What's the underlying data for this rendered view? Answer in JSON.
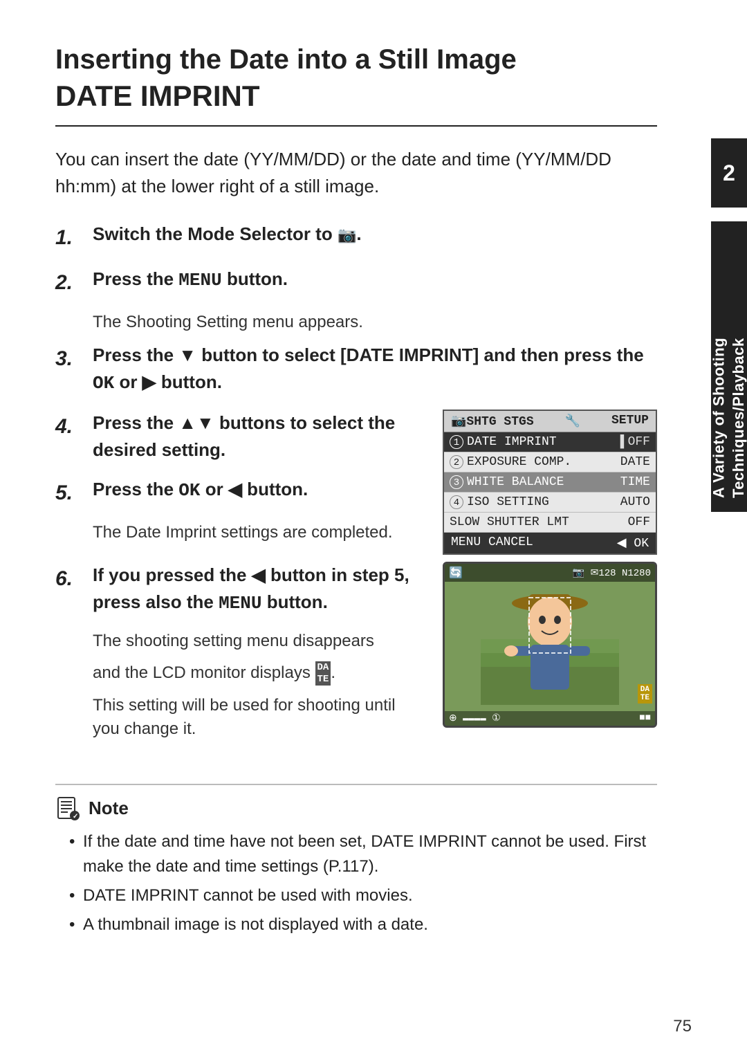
{
  "page": {
    "title_main": "Inserting the Date into a Still Image",
    "title_sub": "DATE IMPRINT",
    "intro": "You can insert the date (YY/MM/DD) or the date and time (YY/MM/DD hh:mm) at the lower right of a still image.",
    "steps": [
      {
        "number": "1.",
        "bold_text": "Switch the Mode Selector to ",
        "symbol": "📷",
        "rest": "."
      },
      {
        "number": "2.",
        "bold_text": "Press the ",
        "mono": "MENU",
        "bold_after": " button.",
        "sub": "The Shooting Setting menu appears."
      },
      {
        "number": "3.",
        "bold_text": "Press the ▼ button to select [DATE IMPRINT] and then press the OK or ▶ button."
      },
      {
        "number": "4.",
        "bold_text": "Press the ▲▼ buttons to select the desired setting."
      },
      {
        "number": "5.",
        "bold_text": "Press the ",
        "mono": "OK",
        "bold_after": " or ◀ button.",
        "sub": "The Date Imprint settings are completed."
      },
      {
        "number": "6.",
        "bold_part1": "If you pressed the ◀ button in step 5, press also the ",
        "mono": "MENU",
        "bold_part2": " button.",
        "sub1": "The shooting setting menu disappears",
        "sub2": "and the LCD monitor displays",
        "sub3": "This setting will be used for shooting until you change it."
      }
    ],
    "menu": {
      "header_left": "📷SHTG STGS",
      "header_icon": "🔧",
      "header_right": "SETUP",
      "rows": [
        {
          "num": "1",
          "label": "DATE IMPRINT",
          "value": "OFF",
          "highlighted": true
        },
        {
          "num": "2",
          "label": "EXPOSURE COMP.",
          "value": "DATE",
          "highlighted": false
        },
        {
          "num": "3",
          "label": "WHITE BALANCE",
          "value": "TIME",
          "highlighted": false,
          "selected": true
        },
        {
          "num": "4",
          "label": "ISO SETTING",
          "value": "AUTO",
          "highlighted": false
        },
        {
          "num": "",
          "label": "SLOW SHUTTER LMT",
          "value": "OFF",
          "highlighted": false
        }
      ],
      "footer_left": "MENUCANCEL",
      "footer_right": "◀ OK"
    },
    "note": {
      "header": "Note",
      "items": [
        "If the date and time have not been set, DATE IMPRINT cannot be used. First make the date and time settings (P.117).",
        "DATE IMPRINT cannot be used with movies.",
        "A thumbnail image is not displayed with a date."
      ]
    },
    "side_tab": "A Variety of Shooting Techniques/Playback",
    "chapter_number": "2",
    "page_number": "75"
  }
}
